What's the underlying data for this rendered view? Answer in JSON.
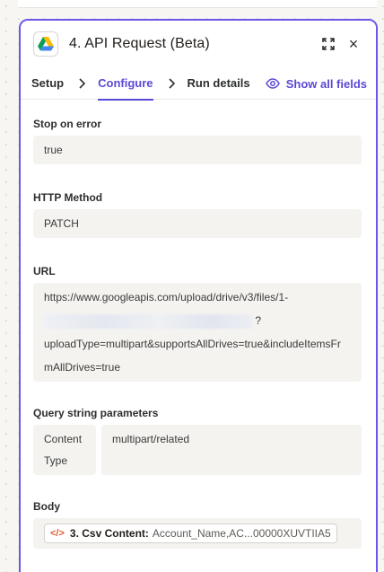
{
  "header": {
    "title": "4. API Request (Beta)",
    "app_icon": "google-drive-icon",
    "expand_icon": "expand-icon",
    "close_label": "×"
  },
  "tabs": [
    {
      "label": "Setup"
    },
    {
      "label": "Configure"
    },
    {
      "label": "Run details"
    }
  ],
  "tabs_active": "Configure",
  "show_all_fields": "Show all fields",
  "fields": {
    "stop_on_error": {
      "label": "Stop on error",
      "value": "true"
    },
    "http_method": {
      "label": "HTTP Method",
      "value": "PATCH"
    },
    "url": {
      "label": "URL",
      "line1": "https://www.googleapis.com/upload/drive/v3/files/1-",
      "after_redacted": "?",
      "line3": "uploadType=multipart&supportsAllDrives=true&includeItemsFr",
      "line4": "mAllDrives=true"
    },
    "query_string": {
      "label": "Query string parameters",
      "rows": [
        {
          "key": "Content Type",
          "value": "multipart/related"
        }
      ]
    },
    "body": {
      "label": "Body",
      "pill": {
        "step": "3. Csv Content:",
        "value": "Account_Name,AC...00000XUVTIIA5"
      }
    }
  },
  "colors": {
    "accent": "#5a49d6",
    "panel_border": "#6b58e6",
    "code_icon": "#e05b2e"
  }
}
